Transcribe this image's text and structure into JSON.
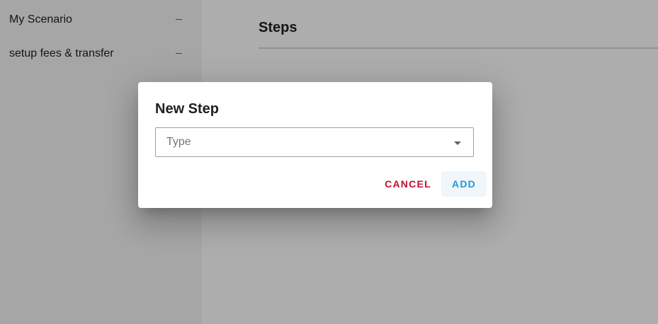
{
  "sidebar": {
    "items": [
      {
        "label": "My Scenario",
        "remove_symbol": "–"
      },
      {
        "label": "setup fees & transfer",
        "remove_symbol": "–"
      }
    ]
  },
  "main": {
    "title": "Steps"
  },
  "dialog": {
    "title": "New Step",
    "type_field": {
      "placeholder": "Type",
      "value": ""
    },
    "cancel_label": "CANCEL",
    "add_label": "ADD"
  },
  "colors": {
    "cancel": "#c2112f",
    "add": "#1e9ad6",
    "scrim": "rgba(0,0,0,0.32)"
  },
  "icons": {
    "dropdown": "arrow-drop-down-icon",
    "remove": "remove-icon"
  }
}
